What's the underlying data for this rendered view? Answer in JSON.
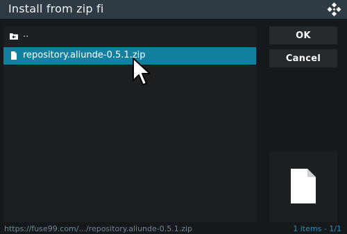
{
  "dialog": {
    "title": "Install from zip fi",
    "logo_icon": "kodi-logo-icon"
  },
  "file_list": {
    "items": [
      {
        "label": "..",
        "icon": "folder-back-icon",
        "selected": false
      },
      {
        "label": "repository.aliunde-0.5.1.zip",
        "icon": "file-icon",
        "selected": true
      }
    ]
  },
  "buttons": {
    "ok_label": "OK",
    "cancel_label": "Cancel"
  },
  "preview": {
    "icon": "file-large-icon"
  },
  "status": {
    "path": "https://fuse99.com/.../repository.aliunde-0.5.1.zip",
    "count": "1 items - 1/1"
  },
  "colors": {
    "titlebar": "#2e3b44",
    "selection": "#12809f",
    "background": "#15191c",
    "panel": "#1c2023",
    "count_text": "#2e8fb3"
  }
}
